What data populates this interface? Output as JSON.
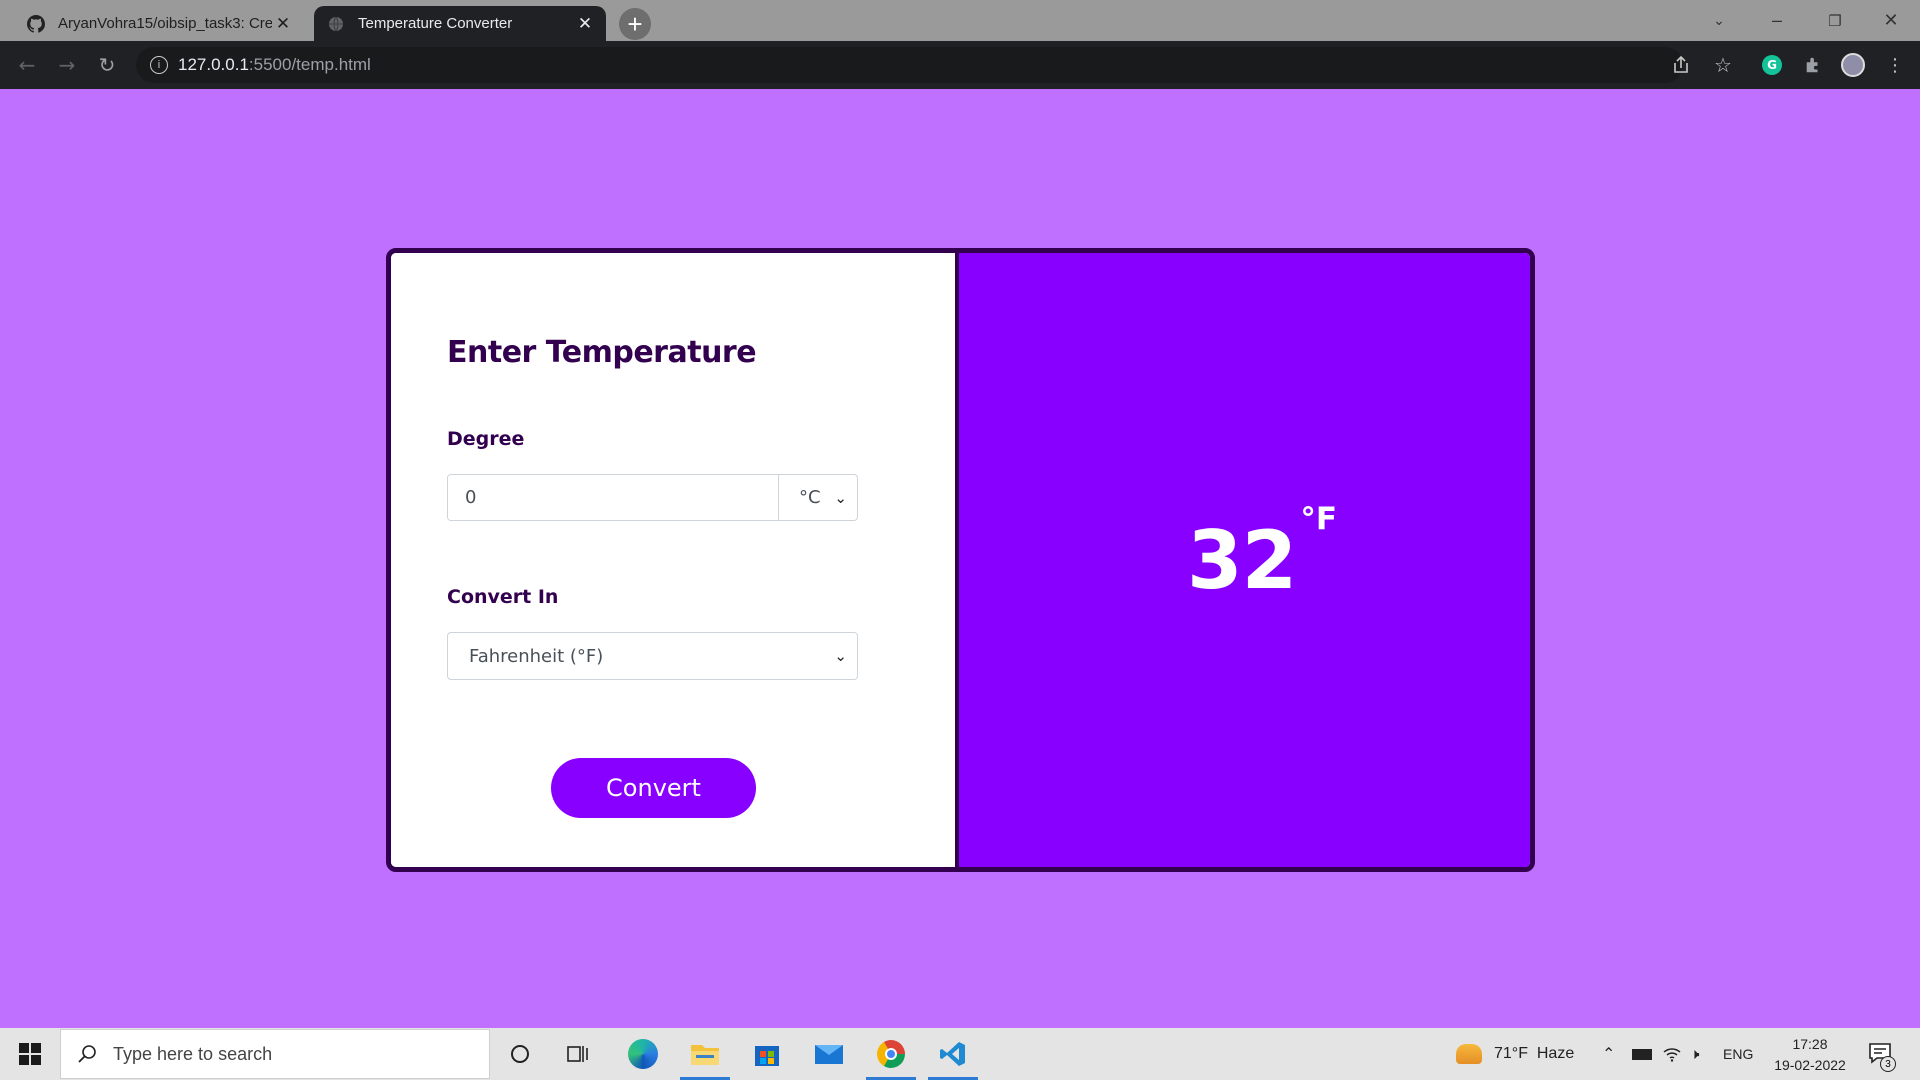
{
  "browser": {
    "tabs": [
      {
        "title": "AryanVohra15/oibsip_task3: Crea",
        "icon": "github-icon",
        "active": false
      },
      {
        "title": "Temperature Converter",
        "icon": "globe-icon",
        "active": true
      }
    ],
    "url_host": "127.0.0.1",
    "url_path": ":5500/temp.html"
  },
  "page": {
    "form_title": "Enter Temperature",
    "degree_label": "Degree",
    "degree_value": "0",
    "degree_unit": "°C",
    "convert_label": "Convert In",
    "convert_selected": "Fahrenheit (°F)",
    "convert_button": "Convert",
    "result_value": "32",
    "result_unit": "°F",
    "colors": {
      "background": "#bf70ff",
      "accent": "#8800ff",
      "dark": "#32004f"
    }
  },
  "taskbar": {
    "search_placeholder": "Type here to search",
    "weather": "71°F  Haze",
    "language": "ENG",
    "time": "17:28",
    "date": "19-02-2022",
    "notification_count": "3"
  }
}
